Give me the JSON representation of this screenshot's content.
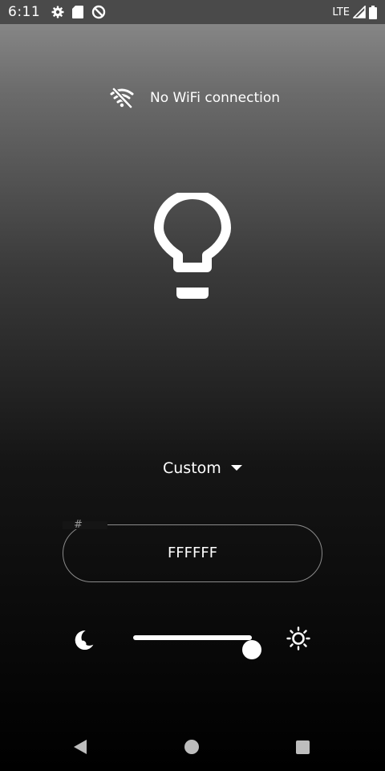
{
  "status_bar": {
    "time": "6:11",
    "network": "LTE",
    "left_icons": [
      "gear-icon",
      "sd-card-icon",
      "no-sync-icon"
    ],
    "right_icons": [
      "signal-icon",
      "battery-icon"
    ]
  },
  "connection": {
    "message": "No WiFi connection",
    "icon": "wifi-off-icon"
  },
  "light": {
    "icon": "lightbulb-icon",
    "color": "#ffffff"
  },
  "mode": {
    "selected": "Custom"
  },
  "color_input": {
    "prefix": "#",
    "value": "FFFFFF"
  },
  "brightness": {
    "level": 1.0,
    "min_icon": "moon-icon",
    "max_icon": "sun-icon"
  },
  "nav": {
    "icons": [
      "back-icon",
      "home-icon",
      "recents-icon"
    ]
  }
}
